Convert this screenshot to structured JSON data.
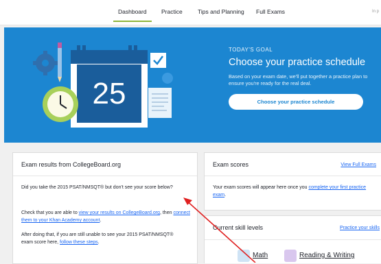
{
  "nav": {
    "tabs": [
      {
        "label": "Dashboard",
        "active": true
      },
      {
        "label": "Practice",
        "active": false
      },
      {
        "label": "Tips and Planning",
        "active": false
      },
      {
        "label": "Full Exams",
        "active": false
      }
    ],
    "overflow_text": "In p"
  },
  "hero": {
    "calendar_number": "25",
    "kicker": "TODAY'S GOAL",
    "title": "Choose your practice schedule",
    "description": "Based on your exam date, we'll put together a practice plan to ensure you're ready for the real deal.",
    "button_label": "Choose your practice schedule",
    "colors": {
      "background": "#1c86d1",
      "accent_green": "#a8d05a",
      "dark_blue": "#1a5d9b"
    }
  },
  "exam_results": {
    "title": "Exam results from CollegeBoard.org",
    "p1": "Did you take the 2015 PSAT/NMSQT® but don't see your score below?",
    "p2_before": "Check that you are able to ",
    "p2_link1": "view your results on CollegeBoard.org",
    "p2_mid": ", then ",
    "p2_link2": "connect them to your Khan Academy account",
    "p2_after": ".",
    "p3_before": "After doing that, if you are still unable to see your 2015 PSAT/NMSQT® exam score here, ",
    "p3_link": "follow these steps",
    "p3_after": "."
  },
  "exam_scores": {
    "title": "Exam scores",
    "link": "View Full Exams",
    "text_before": "Your exam scores will appear here once you ",
    "text_link": "complete your first practice exam",
    "text_after": "."
  },
  "skills": {
    "title": "Current skill levels",
    "link": "Practice your skills",
    "items": [
      {
        "label": "Math",
        "icon": "math-icon"
      },
      {
        "label": "Reading & Writing",
        "icon": "reading-writing-icon"
      }
    ]
  },
  "annotation": {
    "arrow_color": "#e02020"
  }
}
